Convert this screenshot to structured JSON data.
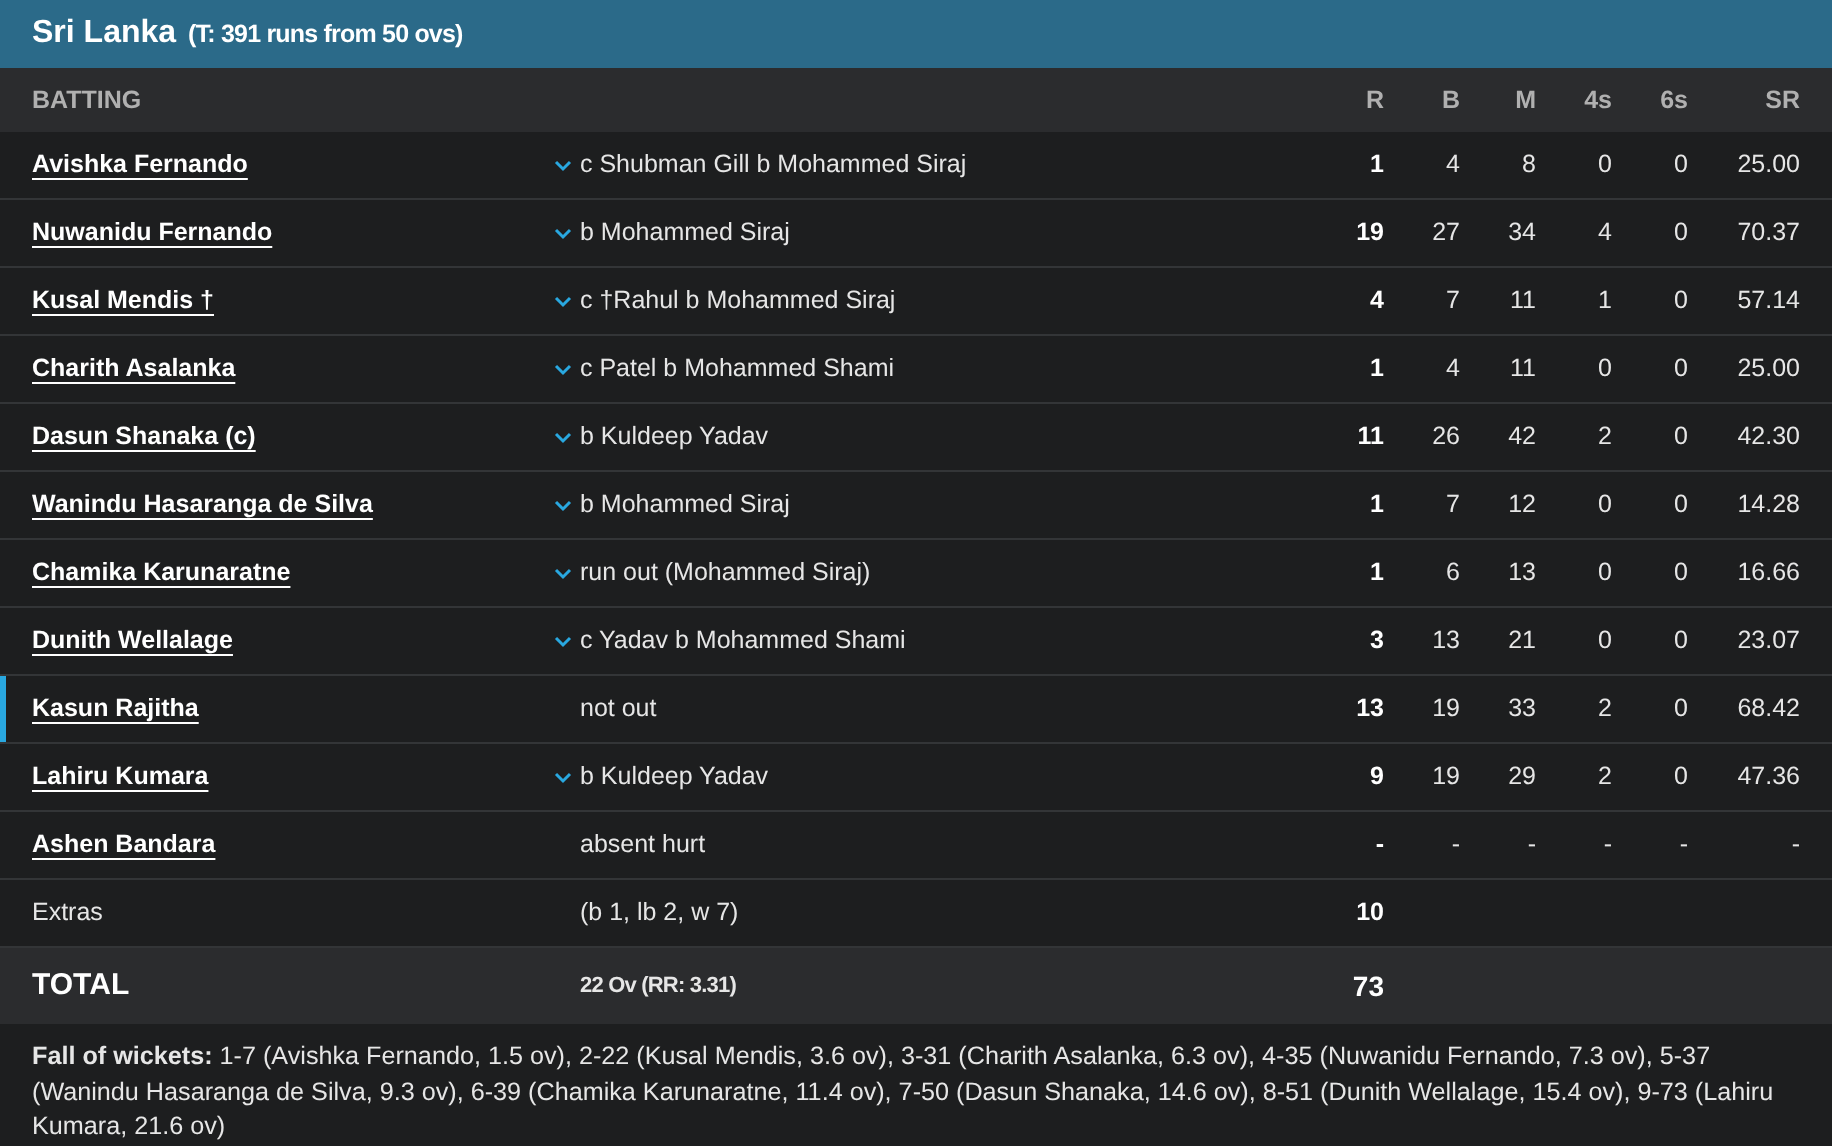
{
  "team": {
    "name": "Sri Lanka",
    "target": "(T: 391 runs from 50 ovs)"
  },
  "columns": [
    "BATTING",
    "R",
    "B",
    "M",
    "4s",
    "6s",
    "SR"
  ],
  "batters": [
    {
      "name": "Avishka Fernando",
      "dismissal": "c Shubman Gill b Mohammed Siraj",
      "expandable": true,
      "at_crease": false,
      "r": "1",
      "b": "4",
      "m": "8",
      "fours": "0",
      "sixes": "0",
      "sr": "25.00"
    },
    {
      "name": "Nuwanidu Fernando",
      "dismissal": "b Mohammed Siraj",
      "expandable": true,
      "at_crease": false,
      "r": "19",
      "b": "27",
      "m": "34",
      "fours": "4",
      "sixes": "0",
      "sr": "70.37"
    },
    {
      "name": "Kusal Mendis †",
      "dismissal": "c †Rahul b Mohammed Siraj",
      "expandable": true,
      "at_crease": false,
      "r": "4",
      "b": "7",
      "m": "11",
      "fours": "1",
      "sixes": "0",
      "sr": "57.14"
    },
    {
      "name": "Charith Asalanka",
      "dismissal": "c Patel b Mohammed Shami",
      "expandable": true,
      "at_crease": false,
      "r": "1",
      "b": "4",
      "m": "11",
      "fours": "0",
      "sixes": "0",
      "sr": "25.00"
    },
    {
      "name": "Dasun Shanaka (c)",
      "dismissal": "b Kuldeep Yadav",
      "expandable": true,
      "at_crease": false,
      "r": "11",
      "b": "26",
      "m": "42",
      "fours": "2",
      "sixes": "0",
      "sr": "42.30"
    },
    {
      "name": "Wanindu Hasaranga de Silva",
      "dismissal": "b Mohammed Siraj",
      "expandable": true,
      "at_crease": false,
      "r": "1",
      "b": "7",
      "m": "12",
      "fours": "0",
      "sixes": "0",
      "sr": "14.28"
    },
    {
      "name": "Chamika Karunaratne",
      "dismissal": "run out (Mohammed Siraj)",
      "expandable": true,
      "at_crease": false,
      "r": "1",
      "b": "6",
      "m": "13",
      "fours": "0",
      "sixes": "0",
      "sr": "16.66"
    },
    {
      "name": "Dunith Wellalage",
      "dismissal": "c Yadav b Mohammed Shami",
      "expandable": true,
      "at_crease": false,
      "r": "3",
      "b": "13",
      "m": "21",
      "fours": "0",
      "sixes": "0",
      "sr": "23.07"
    },
    {
      "name": "Kasun Rajitha",
      "dismissal": "not out",
      "expandable": false,
      "at_crease": true,
      "r": "13",
      "b": "19",
      "m": "33",
      "fours": "2",
      "sixes": "0",
      "sr": "68.42"
    },
    {
      "name": "Lahiru Kumara",
      "dismissal": "b Kuldeep Yadav",
      "expandable": true,
      "at_crease": false,
      "r": "9",
      "b": "19",
      "m": "29",
      "fours": "2",
      "sixes": "0",
      "sr": "47.36"
    },
    {
      "name": "Ashen Bandara",
      "dismissal": "absent hurt",
      "expandable": false,
      "at_crease": false,
      "r": "-",
      "b": "-",
      "m": "-",
      "fours": "-",
      "sixes": "-",
      "sr": "-"
    }
  ],
  "extras": {
    "label": "Extras",
    "detail": "(b 1, lb 2, w 7)",
    "runs": "10"
  },
  "total": {
    "label": "TOTAL",
    "detail": "22 Ov (RR: 3.31)",
    "runs": "73"
  },
  "fall_of_wickets": "**Fall of wickets:** 1-7 (Avishka Fernando, 1.5 ov), 2-22 (Kusal Mendis, 3.6 ov), 3-31 (Charith Asalanka, 6.3 ov), 4-35 (Nuwanidu Fernando, 7.3 ov), 5-37 (Wanindu Hasaranga de Silva, 9.3 ov), 6-39 (Chamika Karunaratne, 11.4 ov), 7-50 (Dasun Shanaka, 14.6 ov), 8-51 (Dunith Wellalage, 15.4 ov), 9-73 (Lahiru Kumara, 21.6 ov)"
}
